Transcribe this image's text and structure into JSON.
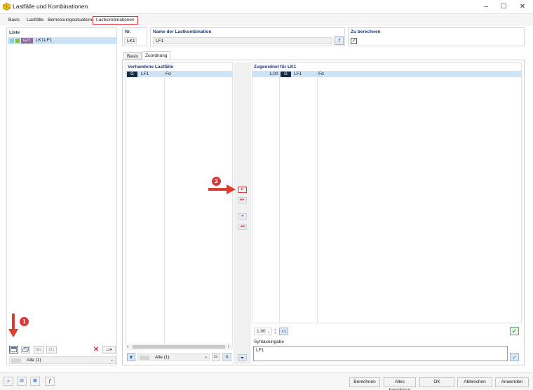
{
  "window": {
    "title": "Lastfälle und Kombinationen"
  },
  "tabs": [
    {
      "label": "Basis"
    },
    {
      "label": "Lastfälle"
    },
    {
      "label": "Bemessungssituationen"
    },
    {
      "label": "Lastkombinationen"
    }
  ],
  "left_panel": {
    "header": "Liste",
    "items": [
      {
        "tag": "GZT",
        "id": "LK1",
        "name": "LF1"
      }
    ],
    "filter": "Alle (1)"
  },
  "header_fields": {
    "nr_label": "Nr.",
    "nr_value": "LK1",
    "name_label": "Name der Lastkombination",
    "name_value": "LF1",
    "calc_label": "Zu berechnen"
  },
  "sub_tabs": [
    {
      "label": "Basis"
    },
    {
      "label": "Zuordnung"
    }
  ],
  "available": {
    "header": "Vorhandene Lastfälle",
    "rows": [
      {
        "type": "G",
        "name": "LF1",
        "extra": "Fd"
      }
    ],
    "filter": "Alle (1)"
  },
  "assigned": {
    "header": "Zugeordnet für LK1",
    "rows": [
      {
        "factor": "1.00",
        "type": "G",
        "name": "LF1",
        "extra": "Fd"
      }
    ],
    "factor_select": "1.00",
    "syntax_label": "Syntaxeingabe",
    "syntax_value": "LF1"
  },
  "transfer": {
    "add_one": "▸",
    "add_all": "▸▸",
    "remove_one": "◂",
    "remove_all": "◂◂"
  },
  "markers": {
    "one": "1",
    "two": "2"
  },
  "footer": {
    "buttons": [
      {
        "label": "Berechnen"
      },
      {
        "label": "Alles berechnen"
      },
      {
        "label": "OK"
      },
      {
        "label": "Abbrechen"
      },
      {
        "label": "Anwenden"
      }
    ]
  }
}
